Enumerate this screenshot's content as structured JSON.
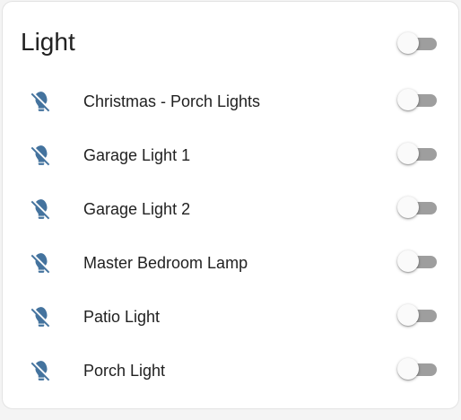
{
  "card": {
    "title": "Light",
    "master_toggle": {
      "state": "off"
    }
  },
  "entities": [
    {
      "name": "Christmas - Porch Lights",
      "icon": "lightbulb-off-icon",
      "state": "off"
    },
    {
      "name": "Garage Light 1",
      "icon": "lightbulb-off-icon",
      "state": "off"
    },
    {
      "name": "Garage Light 2",
      "icon": "lightbulb-off-icon",
      "state": "off"
    },
    {
      "name": "Master Bedroom Lamp",
      "icon": "lightbulb-off-icon",
      "state": "off"
    },
    {
      "name": "Patio Light",
      "icon": "lightbulb-off-icon",
      "state": "off"
    },
    {
      "name": "Porch Light",
      "icon": "lightbulb-off-icon",
      "state": "off"
    }
  ],
  "colors": {
    "icon": "#44739e",
    "text": "#212121",
    "toggle_track_off": "#9e9e9e",
    "toggle_thumb_off": "#fafafa",
    "card_background": "#ffffff",
    "page_background": "#f4f4f4"
  }
}
